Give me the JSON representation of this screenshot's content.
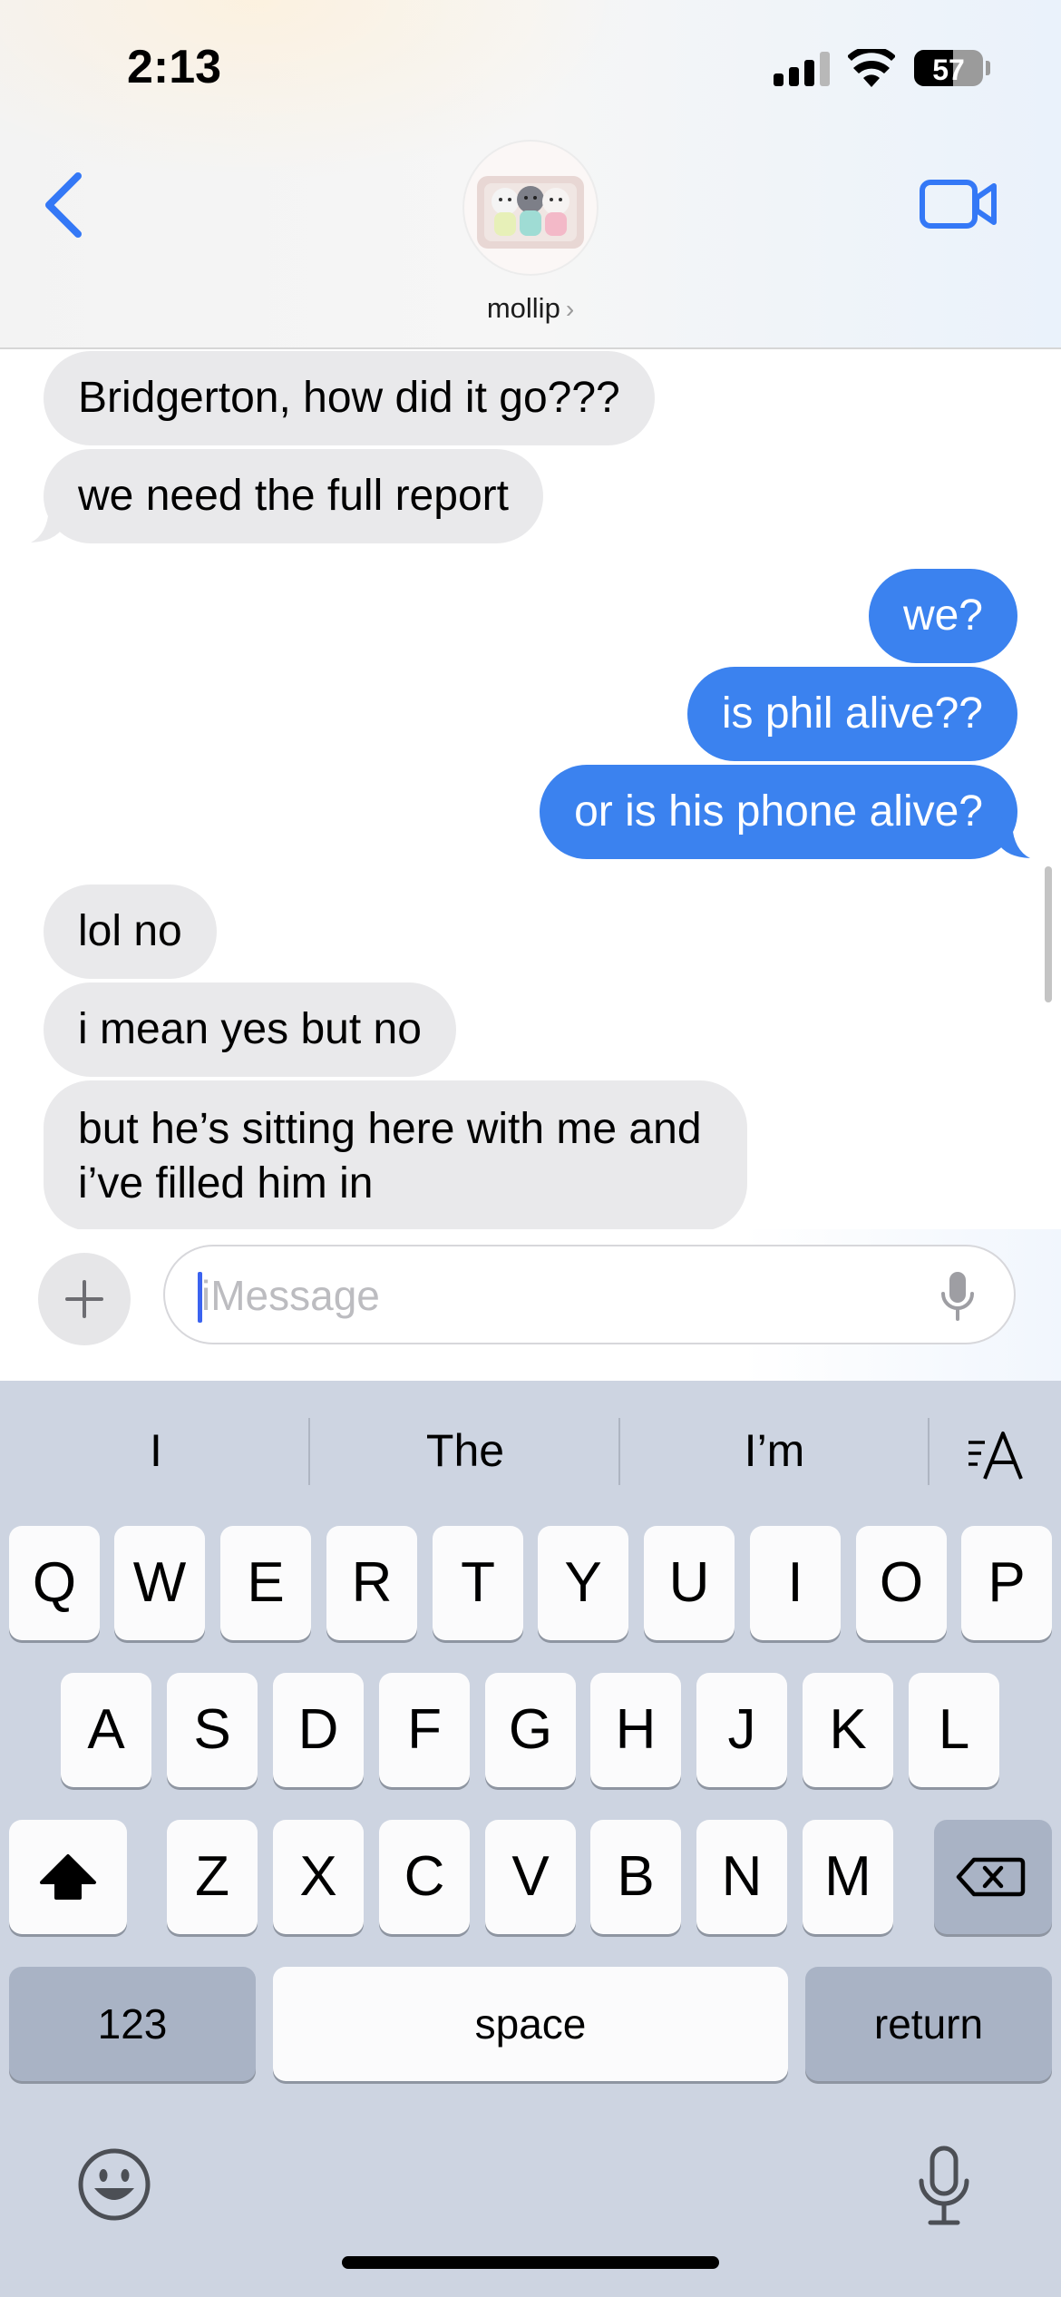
{
  "status_bar": {
    "time": "2:13",
    "battery": "57",
    "battery_level": 0.57
  },
  "header": {
    "back_icon": "chevron-left-icon",
    "contact_name": "mollip",
    "contact_chevron": "›",
    "video_icon": "video-camera-icon",
    "accent_color": "#3478f6"
  },
  "messages": [
    {
      "direction": "received",
      "text": "Bridgerton, how did it go???"
    },
    {
      "direction": "received",
      "text": "we need the full report"
    },
    {
      "direction": "sent",
      "text": "we?"
    },
    {
      "direction": "sent",
      "text": "is phil alive??"
    },
    {
      "direction": "sent",
      "text": "or is his phone alive?"
    },
    {
      "direction": "received",
      "text": "lol no"
    },
    {
      "direction": "received",
      "text": "i mean yes but no"
    },
    {
      "direction": "received",
      "lines": [
        "but he’s sitting here with me and",
        "i’ve filled him in"
      ]
    }
  ],
  "input": {
    "placeholder": "iMessage",
    "plus_icon": "plus-icon",
    "mic_icon": "microphone-icon"
  },
  "keyboard": {
    "suggestions": [
      "I",
      "The",
      "I’m"
    ],
    "format_icon": "text-format-icon",
    "row1": [
      "Q",
      "W",
      "E",
      "R",
      "T",
      "Y",
      "U",
      "I",
      "O",
      "P"
    ],
    "row2": [
      "A",
      "S",
      "D",
      "F",
      "G",
      "H",
      "J",
      "K",
      "L"
    ],
    "row3": [
      "Z",
      "X",
      "C",
      "V",
      "B",
      "N",
      "M"
    ],
    "shift_icon": "shift-icon",
    "delete_icon": "delete-icon",
    "numbers_label": "123",
    "space_label": "space",
    "return_label": "return",
    "emoji_icon": "emoji-icon",
    "dictation_icon": "microphone-icon"
  },
  "colors": {
    "sent_bubble": "#3b82ef",
    "received_bubble": "#e9e9eb",
    "keyboard_bg": "#cdd4e1"
  }
}
